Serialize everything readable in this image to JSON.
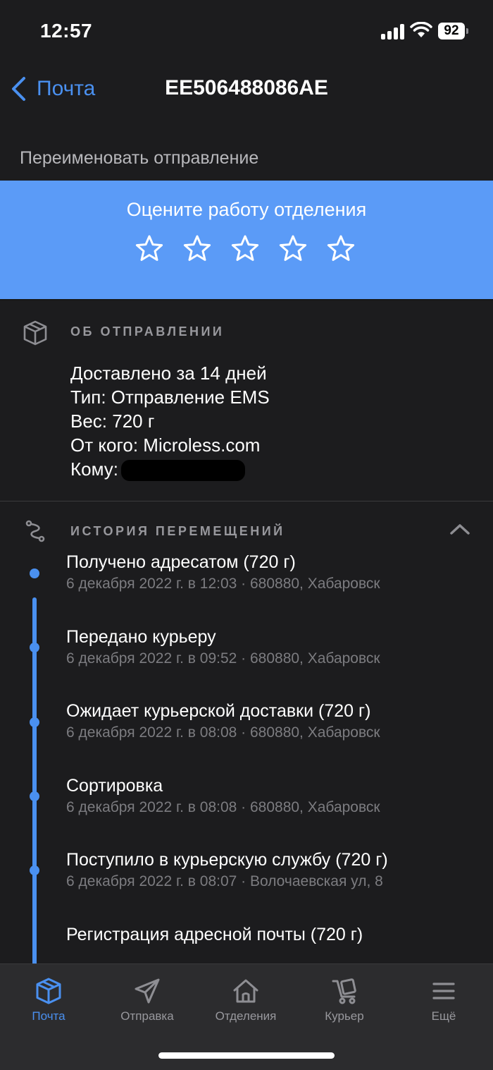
{
  "status_bar": {
    "time": "12:57",
    "battery": "92"
  },
  "nav": {
    "back_label": "Почта",
    "title": "EE506488086AE"
  },
  "rename": {
    "label": "Переименовать отправление"
  },
  "rating": {
    "title": "Оцените работу отделения",
    "star_count": 5,
    "selected_stars": 0
  },
  "about": {
    "header": "ОБ ОТПРАВЛЕНИИ",
    "lines": [
      "Доставлено за 14 дней",
      "Тип: Отправление EMS",
      "Вес: 720 г",
      "От кого: Microless.com"
    ],
    "recipient_label": "Кому:"
  },
  "history": {
    "header": "ИСТОРИЯ ПЕРЕМЕЩЕНИЙ",
    "events": [
      {
        "title": "Получено адресатом  (720 г)",
        "meta": "6 декабря 2022 г. в 12:03 · 680880, Хабаровск"
      },
      {
        "title": "Передано курьеру",
        "meta": "6 декабря 2022 г. в 09:52 · 680880, Хабаровск"
      },
      {
        "title": "Ожидает курьерской доставки  (720 г)",
        "meta": "6 декабря 2022 г. в 08:08 · 680880, Хабаровск"
      },
      {
        "title": "Сортировка",
        "meta": "6 декабря 2022 г. в 08:08 · 680880, Хабаровск"
      },
      {
        "title": "Поступило в курьерскую службу  (720 г)",
        "meta": "6 декабря 2022 г. в 08:07 · Волочаевская ул, 8"
      },
      {
        "title": "Регистрация адресной почты  (720 г)",
        "meta": ""
      }
    ]
  },
  "tabs": [
    {
      "label": "Почта",
      "icon": "box-icon",
      "active": true
    },
    {
      "label": "Отправка",
      "icon": "paper-plane-icon",
      "active": false
    },
    {
      "label": "Отделения",
      "icon": "house-icon",
      "active": false
    },
    {
      "label": "Курьер",
      "icon": "courier-icon",
      "active": false
    },
    {
      "label": "Ещё",
      "icon": "menu-icon",
      "active": false
    }
  ],
  "colors": {
    "accent": "#4a90f0",
    "banner": "#5b9bf7",
    "background": "#1c1c1e"
  }
}
